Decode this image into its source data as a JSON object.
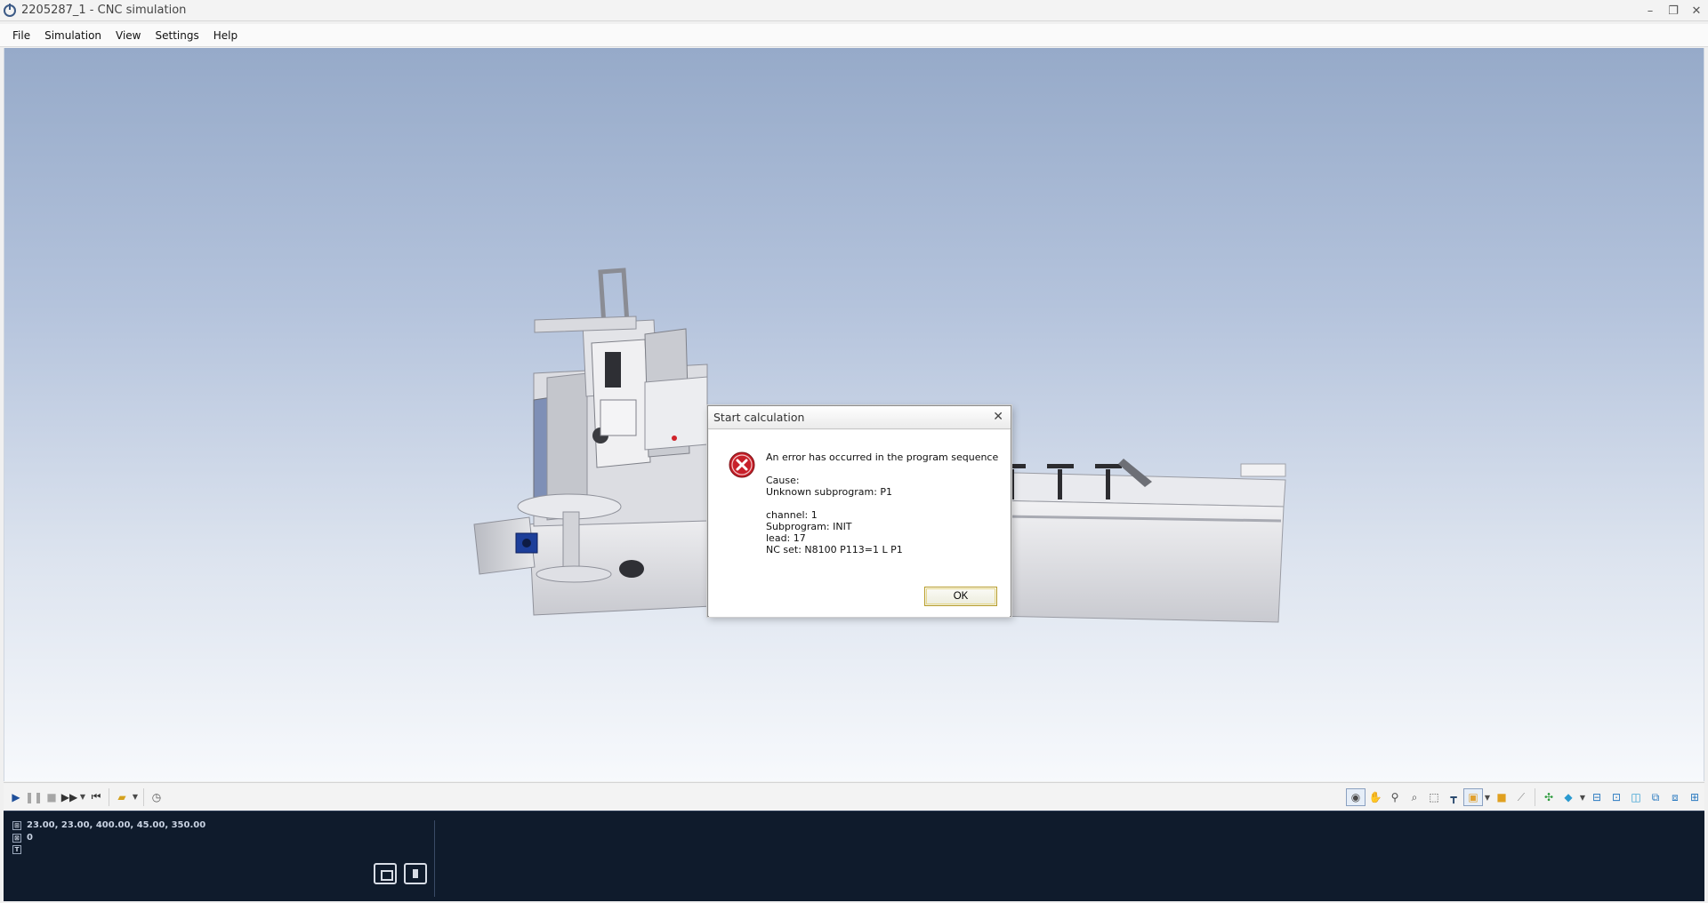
{
  "window": {
    "title": "2205287_1 - CNC simulation",
    "controls": {
      "minimize": "–",
      "maximize": "❐",
      "close": "✕"
    }
  },
  "menu": {
    "items": [
      "File",
      "Simulation",
      "View",
      "Settings",
      "Help"
    ]
  },
  "dialog": {
    "title": "Start calculation",
    "close_glyph": "✕",
    "lines": [
      "An error has occurred in the program sequence",
      "",
      "Cause:",
      "Unknown subprogram: P1",
      "",
      "channel: 1",
      "Subprogram: INIT",
      "lead: 17",
      "NC set: N8100 P113=1 L P1"
    ],
    "ok_label": "OK"
  },
  "toolbar": {
    "left_icons": [
      "play-icon",
      "pause-icon",
      "stop-icon",
      "fast-forward-icon",
      "dropdown-icon",
      "rewind-start-icon",
      "open-folder-icon",
      "dropdown-icon",
      "clock-icon"
    ],
    "right_icons": [
      "camera-icon",
      "pan-hand-icon",
      "zoom-icon",
      "zoom-fit-icon",
      "select-icon",
      "tool-icon",
      "view-material-icon",
      "dropdown-icon",
      "cube-icon",
      "measure-icon",
      "axes-icon",
      "iso-view-icon",
      "dropdown-icon",
      "front-view-icon",
      "top-view-icon",
      "side-view-icon",
      "right-view-icon",
      "back-view-icon",
      "bottom-view-icon"
    ]
  },
  "status": {
    "coordinates": "23.00, 23.00, 400.00, 45.00, 350.00",
    "value": "0",
    "third": ""
  },
  "colors": {
    "viewport_top": "#96aac9",
    "viewport_bottom": "#f7f9fc",
    "status_bg": "#0f1b2c",
    "error_red": "#c8202a",
    "ok_border": "#b89d2c"
  }
}
